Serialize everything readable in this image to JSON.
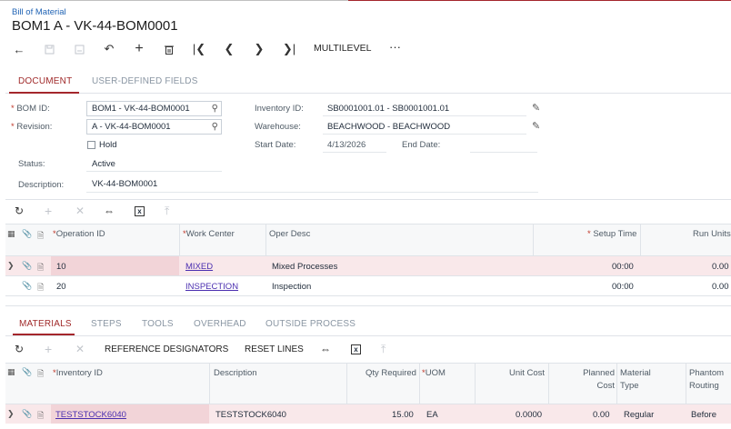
{
  "breadcrumb": "Bill of Material",
  "page_title": "BOM1 A - VK-44-BOM0001",
  "toolbar": {
    "multilevel": "MULTILEVEL",
    "more": "···"
  },
  "tabs": [
    {
      "label": "DOCUMENT",
      "active": true
    },
    {
      "label": "USER-DEFINED FIELDS",
      "active": false
    }
  ],
  "form": {
    "bom_id_label": "BOM ID:",
    "bom_id_value": "BOM1 - VK-44-BOM0001",
    "revision_label": "Revision:",
    "revision_value": "A - VK-44-BOM0001",
    "hold_label": "Hold",
    "status_label": "Status:",
    "status_value": "Active",
    "description_label": "Description:",
    "description_value": "VK-44-BOM0001",
    "inventory_label": "Inventory ID:",
    "inventory_value": "SB0001001.01 - SB0001001.01",
    "warehouse_label": "Warehouse:",
    "warehouse_value": "BEACHWOOD - BEACHWOOD",
    "start_label": "Start Date:",
    "start_value": "4/13/2026",
    "end_label": "End Date:",
    "end_value": ""
  },
  "operations": {
    "columns": [
      "Operation ID",
      "Work Center",
      "Oper Desc",
      "Setup Time",
      "Run Units"
    ],
    "rows": [
      {
        "op_id": "10",
        "work_center": "MIXED",
        "desc": "Mixed Processes",
        "setup": "00:00",
        "run": "0.00"
      },
      {
        "op_id": "20",
        "work_center": "INSPECTION",
        "desc": "Inspection",
        "setup": "00:00",
        "run": "0.00"
      }
    ]
  },
  "bottom_tabs": [
    {
      "label": "MATERIALS",
      "active": true
    },
    {
      "label": "STEPS",
      "active": false
    },
    {
      "label": "TOOLS",
      "active": false
    },
    {
      "label": "OVERHEAD",
      "active": false
    },
    {
      "label": "OUTSIDE PROCESS",
      "active": false
    }
  ],
  "materials_toolbar": {
    "ref_designators": "REFERENCE DESIGNATORS",
    "reset_lines": "RESET LINES"
  },
  "materials": {
    "columns": {
      "inventory": "Inventory ID",
      "description": "Description",
      "qty": "Qty Required",
      "uom": "UOM",
      "unit_cost": "Unit Cost",
      "planned_cost_1": "Planned",
      "planned_cost_2": "Cost",
      "material_type_1": "Material",
      "material_type_2": "Type",
      "phantom_1": "Phantom",
      "phantom_2": "Routing"
    },
    "rows": [
      {
        "inventory": "TESTSTOCK6040",
        "description": "TESTSTOCK6040",
        "qty": "15.00",
        "uom": "EA",
        "unit_cost": "0.0000",
        "planned_cost": "0.00",
        "material_type": "Regular",
        "phantom": "Before"
      }
    ]
  },
  "colors": {
    "accent": "#a4262c",
    "link": "#4b2fb0",
    "breadcrumb": "#2164b5",
    "selected_row": "#f9e8ea"
  }
}
